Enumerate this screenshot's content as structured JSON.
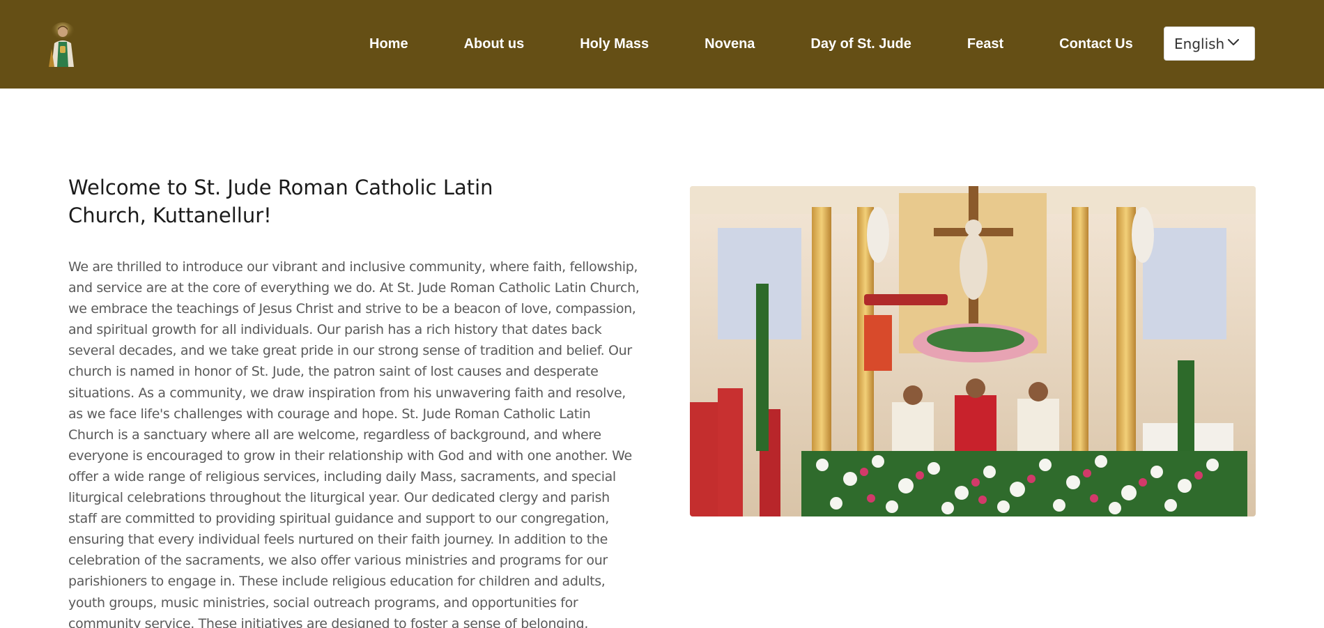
{
  "nav": {
    "logo_icon": "st-jude-logo",
    "links": [
      "Home",
      "About us",
      "Holy Mass",
      "Novena",
      "Day of St. Jude",
      "Feast",
      "Contact Us"
    ],
    "language": "English"
  },
  "colors": {
    "header_bg": "#654f15",
    "nav_text": "#ffffff",
    "body_text": "#5a5a5a",
    "title_text": "#1b1b1b"
  },
  "main": {
    "title": "Welcome to St. Jude Roman Catholic Latin Church, Kuttanellur!",
    "body": "We are thrilled to introduce our vibrant and inclusive community, where faith, fellowship, and service are at the core of everything we do. At St. Jude Roman Catholic Latin Church, we embrace the teachings of Jesus Christ and strive to be a beacon of love, compassion, and spiritual growth for all individuals. Our parish has a rich history that dates back several decades, and we take great pride in our strong sense of tradition and belief. Our church is named in honor of St. Jude, the patron saint of lost causes and desperate situations. As a community, we draw inspiration from his unwavering faith and resolve, as we face life's challenges with courage and hope. St. Jude Roman Catholic Latin Church is a sanctuary where all are welcome, regardless of background, and where everyone is encouraged to grow in their relationship with God and with one another. We offer a wide range of religious services, including daily Mass, sacraments, and special liturgical celebrations throughout the liturgical year. Our dedicated clergy and parish staff are committed to providing spiritual guidance and support to our congregation, ensuring that every individual feels nurtured on their faith journey. In addition to the celebration of the sacraments, we also offer various ministries and programs for our parishioners to engage in. These include religious education for children and adults, youth groups, music ministries, social outreach programs, and opportunities for community service. These initiatives are designed to foster a sense of belonging, promote personal growth, and deepen our connection to the larger community",
    "hero_image": "church-altar-mass-photo"
  }
}
